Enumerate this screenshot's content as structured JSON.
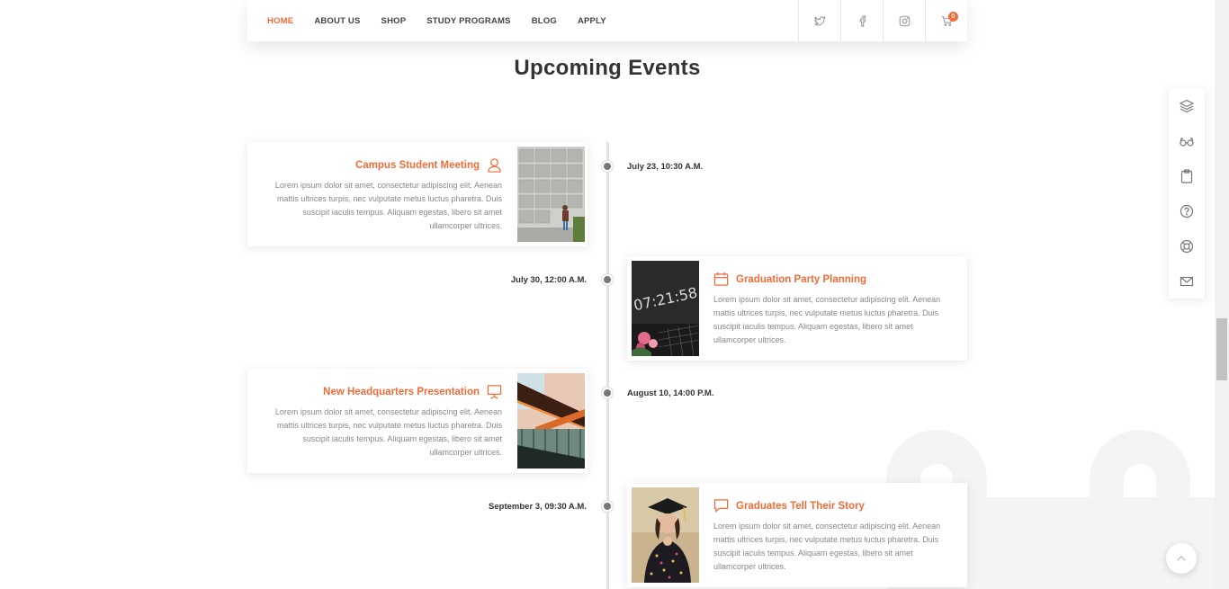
{
  "nav": {
    "items": [
      {
        "label": "HOME",
        "active": true
      },
      {
        "label": "ABOUT US",
        "active": false
      },
      {
        "label": "SHOP",
        "active": false
      },
      {
        "label": "STUDY PROGRAMS",
        "active": false
      },
      {
        "label": "BLOG",
        "active": false
      },
      {
        "label": "APPLY",
        "active": false
      }
    ],
    "social_icons": [
      "twitter-icon",
      "facebook-icon",
      "instagram-icon"
    ],
    "cart_count": "0"
  },
  "section": {
    "title": "Upcoming Events"
  },
  "events": [
    {
      "title": "Campus Student Meeting",
      "icon": "user-icon",
      "date": "July 23, 10:30 A.M.",
      "description": "Lorem ipsum dolor sit amet, consectetur adipiscing elit. Aenean mattis ultrices turpis, nec vulputate metus luctus pharetra. Duis suscipit iaculis tempus. Aliquam egestas, libero sit amet ullamcorper ultrices.",
      "image": "building-photo"
    },
    {
      "title": "Graduation Party Planning",
      "icon": "calendar-icon",
      "date": "July 30, 12:00 A.M.",
      "description": "Lorem ipsum dolor sit amet, consectetur adipiscing elit. Aenean mattis ultrices turpis, nec vulputate metus luctus pharetra. Duis suscipit iaculis tempus. Aliquam egestas, libero sit amet ullamcorper ultrices.",
      "image": "clock-photo",
      "image_text": "07:21:58"
    },
    {
      "title": "New Headquarters Presentation",
      "icon": "presentation-icon",
      "date": "August 10, 14:00 P.M.",
      "description": "Lorem ipsum dolor sit amet, consectetur adipiscing elit. Aenean mattis ultrices turpis, nec vulputate metus luctus pharetra. Duis suscipit iaculis tempus. Aliquam egestas, libero sit amet ullamcorper ultrices.",
      "image": "staircase-photo"
    },
    {
      "title": "Graduates Tell Their Story",
      "icon": "chat-icon",
      "date": "September 3, 09:30 A.M.",
      "description": "Lorem ipsum dolor sit amet, consectetur adipiscing elit. Aenean mattis ultrices turpis, nec vulputate metus luctus pharetra. Duis suscipit iaculis tempus. Aliquam egestas, libero sit amet ullamcorper ultrices.",
      "image": "graduate-photo"
    }
  ],
  "side_widget": [
    "layers-icon",
    "glasses-icon",
    "clipboard-icon",
    "help-icon",
    "lifebuoy-icon",
    "mail-icon"
  ],
  "colors": {
    "accent": "#f26b38",
    "text": "#333333",
    "muted": "#888888"
  }
}
